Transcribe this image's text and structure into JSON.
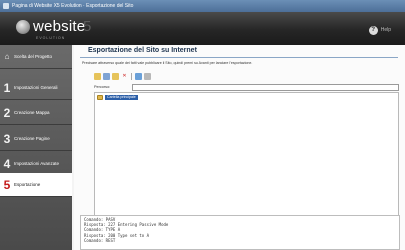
{
  "window": {
    "title": "Pagina di Website X5 Evolution · Esportazione del Sito"
  },
  "header": {
    "logo_text": "website",
    "logo_number": "5",
    "logo_sub": "EVOLUTION",
    "help_label": "Help"
  },
  "sidebar": {
    "items": [
      {
        "num": "",
        "label": "Scelta del Progetto",
        "active": false
      },
      {
        "num": "1",
        "label": "Impostazioni Generali",
        "active": false
      },
      {
        "num": "2",
        "label": "Creazione Mappa",
        "active": false
      },
      {
        "num": "3",
        "label": "Creazione Pagine",
        "active": false
      },
      {
        "num": "4",
        "label": "Impostazioni Avanzate",
        "active": false
      },
      {
        "num": "5",
        "label": "Esportazione",
        "active": true
      }
    ]
  },
  "main": {
    "title": "Esportazione del Sito su Internet",
    "instructions": "Precisare attraverso quale dei fatti vale pubblicare il Sito, quindi premi su Avanti per lanciare l'esportazione.",
    "path_label": "Percorso:",
    "path_value": "",
    "tree_root": "Cartella principale"
  },
  "log": {
    "lines": [
      "Comando: PASV",
      "Risposta: 227 Entering Passive Mode",
      "Comando: TYPE A",
      "Risposta: 200 Type set to A",
      "Comando: REST"
    ]
  }
}
